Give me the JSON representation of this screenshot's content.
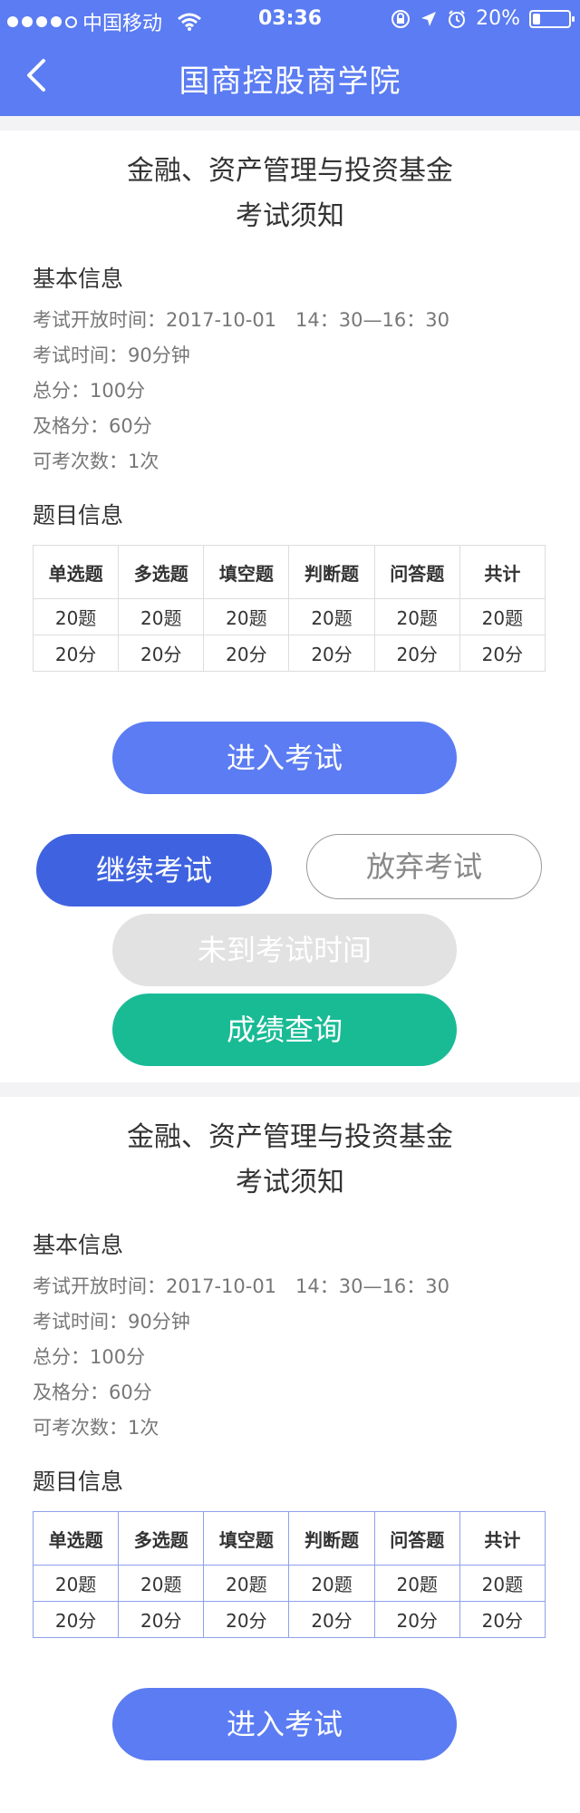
{
  "status_bar": {
    "carrier": "中国移动",
    "time": "03:36",
    "battery": "20%",
    "battery_level": 0.2
  },
  "nav": {
    "title": "国商控股商学院",
    "back_icon": "chevron-left-icon"
  },
  "cards": [
    {
      "title_line1": "金融、资产管理与投资基金",
      "title_line2": "考试须知",
      "basic_title": "基本信息",
      "info": {
        "open_time": "考试开放时间：2017-10-01　14：30—16：30",
        "duration": "考试时间：90分钟",
        "total": "总分：100分",
        "pass": "及格分：60分",
        "attempts": "可考次数：1次"
      },
      "question_title": "题目信息",
      "table": {
        "headers": [
          "单选题",
          "多选题",
          "填空题",
          "判断题",
          "问答题",
          "共计"
        ],
        "counts": [
          "20题",
          "20题",
          "20题",
          "20题",
          "20题",
          "20题"
        ],
        "scores": [
          "20分",
          "20分",
          "20分",
          "20分",
          "20分",
          "20分"
        ]
      }
    },
    {
      "title_line1": "金融、资产管理与投资基金",
      "title_line2": "考试须知",
      "basic_title": "基本信息",
      "info": {
        "open_time": "考试开放时间：2017-10-01　14：30—16：30",
        "duration": "考试时间：90分钟",
        "total": "总分：100分",
        "pass": "及格分：60分",
        "attempts": "可考次数：1次"
      },
      "question_title": "题目信息",
      "table": {
        "headers": [
          "单选题",
          "多选题",
          "填空题",
          "判断题",
          "问答题",
          "共计"
        ],
        "counts": [
          "20题",
          "20题",
          "20题",
          "20题",
          "20题",
          "20题"
        ],
        "scores": [
          "20分",
          "20分",
          "20分",
          "20分",
          "20分",
          "20分"
        ]
      }
    }
  ],
  "buttons": {
    "enter_exam": "进入考试",
    "continue_exam": "继续考试",
    "abandon_exam": "放弃考试",
    "not_yet": "未到考试时间",
    "check_score": "成绩查询"
  },
  "colors": {
    "primary": "#5b7cf2",
    "continue": "#3f63e0",
    "disabled": "#e2e2e2",
    "score": "#19bb95"
  }
}
